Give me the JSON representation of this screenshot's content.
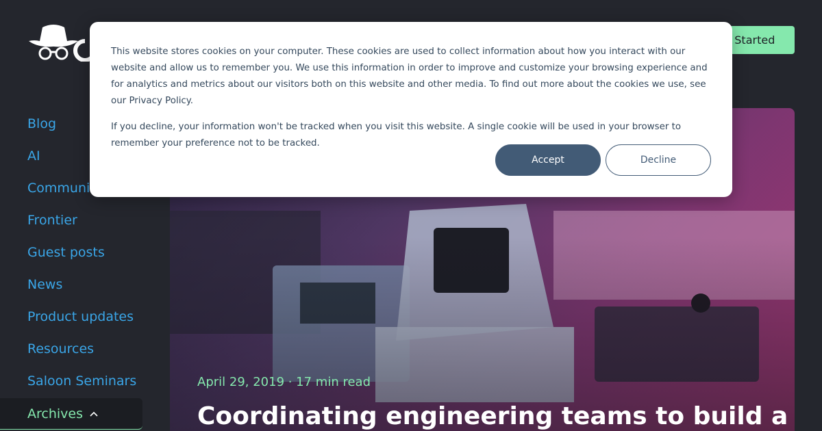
{
  "header": {
    "logo_alt": "cowboy hat and glasses logo",
    "cta_label": "Get Started"
  },
  "sidebar": {
    "items": [
      {
        "label": "Blog"
      },
      {
        "label": "AI"
      },
      {
        "label": "Community"
      },
      {
        "label": "Frontier"
      },
      {
        "label": "Guest posts"
      },
      {
        "label": "News"
      },
      {
        "label": "Product updates"
      },
      {
        "label": "Resources"
      },
      {
        "label": "Saloon Seminars"
      }
    ],
    "archives_label": "Archives"
  },
  "hero": {
    "meta": "April 29, 2019 · 17 min read",
    "title": "Coordinating engineering teams to build a"
  },
  "cookie_banner": {
    "paragraph_1": "This website stores cookies on your computer. These cookies are used to collect information about how you interact with our website and allow us to remember you. We use this information in order to improve and customize your browsing experience and for analytics and metrics about our visitors both on this website and other media. To find out more about the cookies we use, see our Privacy Policy.",
    "paragraph_2": "If you decline, your information won't be tracked when you visit this website. A single cookie will be used in your browser to remember your preference not to be tracked.",
    "accept_label": "Accept",
    "decline_label": "Decline"
  },
  "colors": {
    "background": "#24262d",
    "link": "#3aa6e8",
    "accent": "#85e8ad",
    "button_dark": "#425b76"
  }
}
